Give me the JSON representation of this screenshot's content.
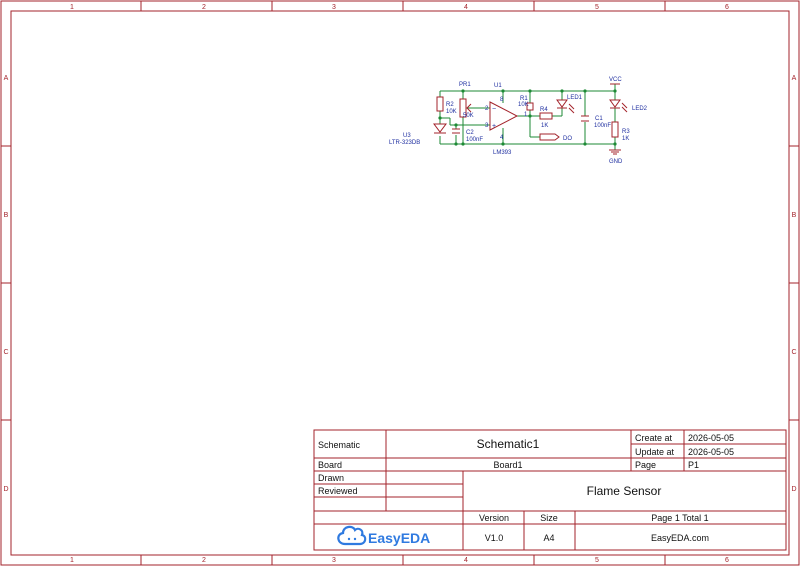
{
  "border": {
    "columns": [
      "1",
      "2",
      "3",
      "4",
      "5",
      "6"
    ],
    "rows": [
      "A",
      "B",
      "C",
      "D"
    ]
  },
  "schematic": {
    "labels": {
      "pr1": "PR1",
      "u1": "U1",
      "r2_ref": "R2",
      "r2_val": "10K",
      "pr1_val": "50K",
      "r1_ref": "R1",
      "r1_val": "10K",
      "r4_ref": "R4",
      "r4_val": "1K",
      "led1": "LED1",
      "led2": "LED2",
      "vcc": "VCC",
      "gnd": "GND",
      "c1_ref": "C1",
      "c1_val": "100nF",
      "c2_ref": "C2",
      "c2_val": "100nF",
      "r3_ref": "R3",
      "r3_val": "1K",
      "u3_ref": "U3",
      "u3_val": "LTR-323DB",
      "lm393": "LM393",
      "do": "DO",
      "pin2": "2",
      "pin3": "3",
      "pin1": "1",
      "pin8": "8",
      "pin4": "4",
      "minus": "−",
      "plus": "+"
    }
  },
  "title_block": {
    "schematic_label": "Schematic",
    "schematic_name": "Schematic1",
    "create_label": "Create at",
    "create_date": "2026-05-05",
    "update_label": "Update at",
    "update_date": "2026-05-05",
    "board_label": "Board",
    "board_name": "Board1",
    "page_label": "Page",
    "page_value": "P1",
    "drawn_label": "Drawn",
    "reviewed_label": "Reviewed",
    "project_title": "Flame Sensor",
    "version_label": "Version",
    "version_value": "V1.0",
    "size_label": "Size",
    "size_value": "A4",
    "page_total": "Page  1  Total  1",
    "logo_text": "EasyEDA",
    "website": "EasyEDA.com"
  },
  "colors": {
    "border": "#a3232b",
    "wire": "#1d8a35",
    "component": "#a3232b",
    "text": "#1f2fa0",
    "logo": "#2f7ae0"
  }
}
